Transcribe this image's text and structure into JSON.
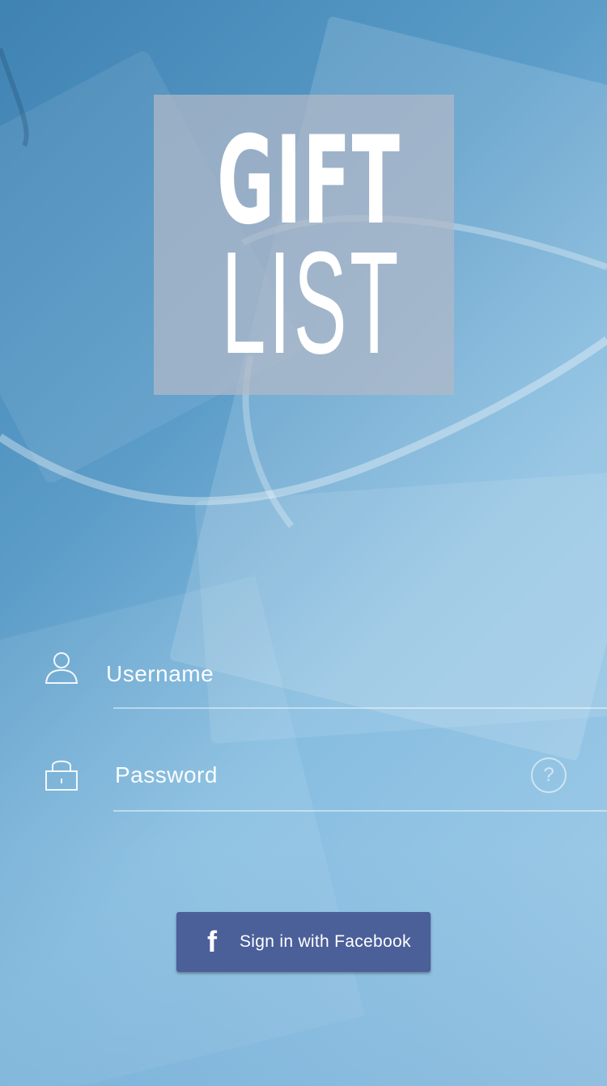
{
  "app": {
    "logo_top": "GIFT",
    "logo_bottom": "LIST"
  },
  "login_form": {
    "username": {
      "placeholder": "Username",
      "value": "",
      "icon": "user-icon"
    },
    "password": {
      "placeholder": "Password",
      "value": "",
      "icon": "lock-icon"
    },
    "help_label": "?"
  },
  "facebook_button": {
    "icon_glyph": "f",
    "label": "Sign in with Facebook",
    "color": "#4b5f99"
  },
  "theme": {
    "background_start": "#3f83b3",
    "background_end": "#a4cde9",
    "logo_box": "#b2b8c8"
  }
}
